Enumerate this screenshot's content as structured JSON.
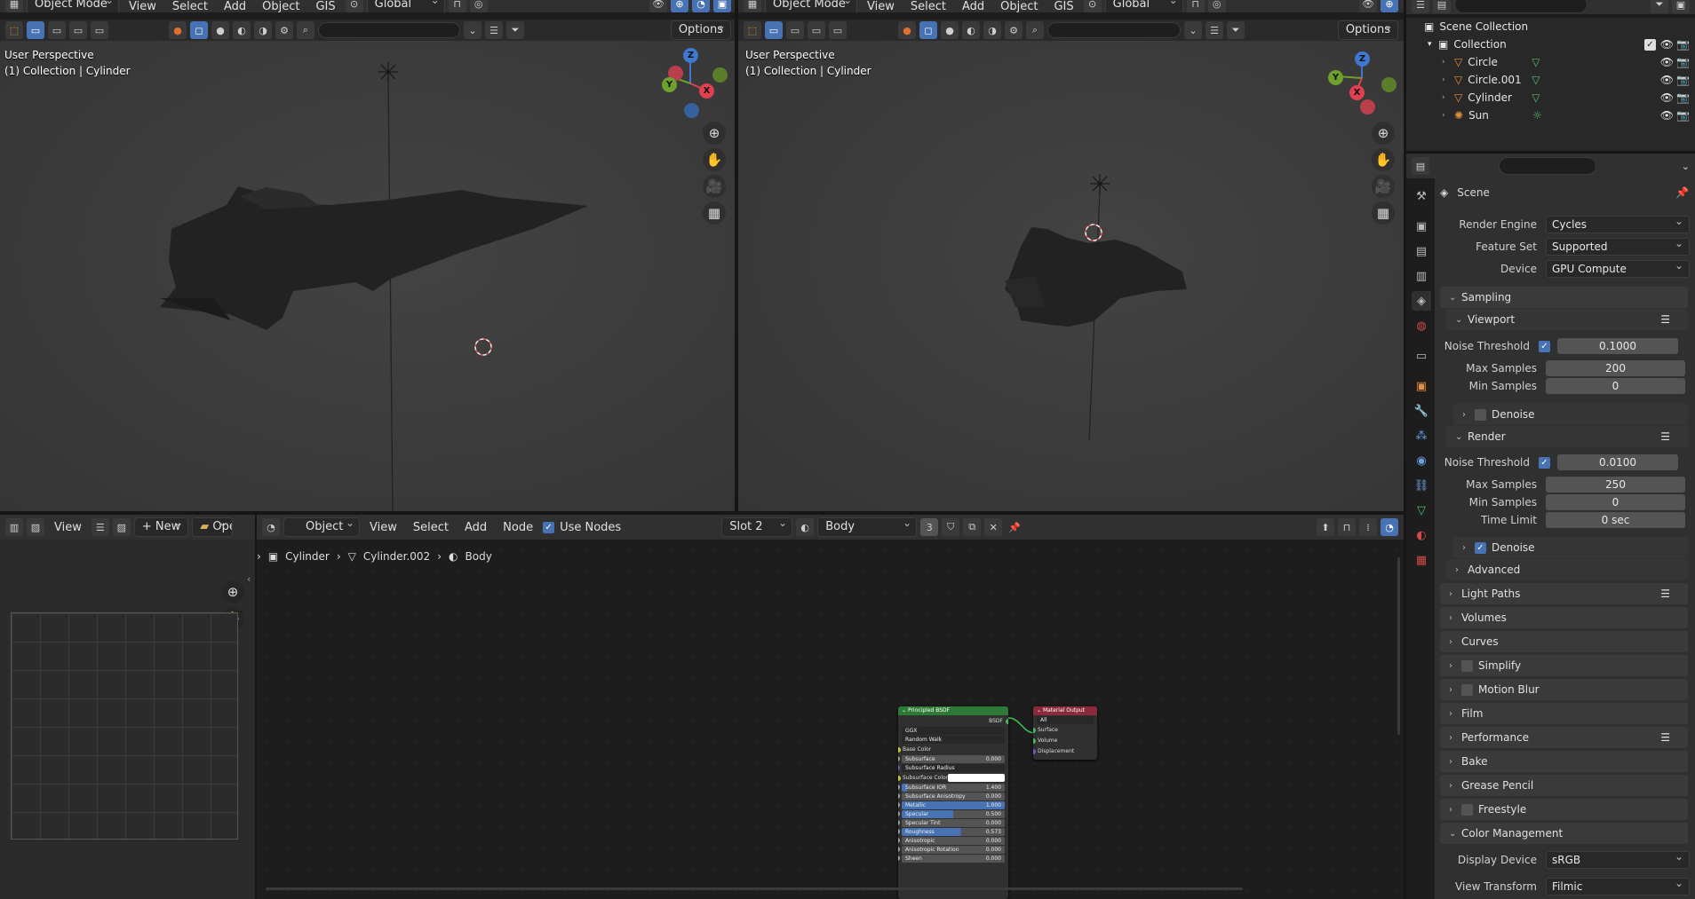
{
  "viewport_left": {
    "mode": "Object Mode",
    "menus": [
      "View",
      "Select",
      "Add",
      "Object",
      "GIS"
    ],
    "orientation": "Global",
    "options": "Options",
    "perspective": "User Perspective",
    "collection": "(1) Collection | Cylinder"
  },
  "viewport_right": {
    "mode": "Object Mode",
    "menus": [
      "View",
      "Select",
      "Add",
      "Object",
      "GIS"
    ],
    "orientation": "Global",
    "options": "Options",
    "perspective": "User Perspective",
    "collection": "(1) Collection | Cylinder"
  },
  "gizmo": {
    "x": "X",
    "y": "Y",
    "z": "Z"
  },
  "image_editor": {
    "view": "View",
    "new": "New",
    "open": "Open"
  },
  "node_editor": {
    "object_dropdown": "Object",
    "menus": [
      "View",
      "Select",
      "Add",
      "Node"
    ],
    "use_nodes": "Use Nodes",
    "slot": "Slot 2",
    "material": "Body",
    "users": "3",
    "breadcrumb": [
      "Cylinder",
      "Cylinder.002",
      "Body"
    ]
  },
  "principled_node": {
    "title": "Principled BSDF",
    "output": "BSDF",
    "distribution": "GGX",
    "subsurface_method": "Random Walk",
    "rows": [
      {
        "label": "Base Color",
        "type": "socket"
      },
      {
        "label": "Subsurface",
        "value": "0.000",
        "type": "bar",
        "fill": 0
      },
      {
        "label": "Subsurface Radius",
        "type": "drop"
      },
      {
        "label": "Subsurface Color",
        "type": "color"
      },
      {
        "label": "Subsurface IOR",
        "value": "1.400",
        "type": "bar",
        "fill": 0.05
      },
      {
        "label": "Subsurface Anisotropy",
        "value": "0.000",
        "type": "bar",
        "fill": 0
      },
      {
        "label": "Metallic",
        "value": "1.000",
        "type": "bar",
        "fill": 1
      },
      {
        "label": "Specular",
        "value": "0.500",
        "type": "bar",
        "fill": 0.5
      },
      {
        "label": "Specular Tint",
        "value": "0.000",
        "type": "bar",
        "fill": 0
      },
      {
        "label": "Roughness",
        "value": "0.573",
        "type": "bar",
        "fill": 0.573
      },
      {
        "label": "Anisotropic",
        "value": "0.000",
        "type": "bar",
        "fill": 0
      },
      {
        "label": "Anisotropic Rotation",
        "value": "0.000",
        "type": "bar",
        "fill": 0
      },
      {
        "label": "Sheen",
        "value": "0.000",
        "type": "bar",
        "fill": 0
      }
    ]
  },
  "output_node": {
    "title": "Material Output",
    "target": "All",
    "inputs": [
      "Surface",
      "Volume",
      "Displacement"
    ]
  },
  "outliner": {
    "root": "Scene Collection",
    "collection": "Collection",
    "items": [
      "Circle",
      "Circle.001",
      "Cylinder",
      "Sun"
    ]
  },
  "properties": {
    "context": "Scene",
    "render_engine_label": "Render Engine",
    "render_engine": "Cycles",
    "feature_set_label": "Feature Set",
    "feature_set": "Supported",
    "device_label": "Device",
    "device": "GPU Compute",
    "sampling": "Sampling",
    "viewport": "Viewport",
    "noise_threshold_label": "Noise Threshold",
    "viewport_noise_threshold": "0.1000",
    "max_samples_label": "Max Samples",
    "viewport_max_samples": "200",
    "min_samples_label": "Min Samples",
    "viewport_min_samples": "0",
    "denoise": "Denoise",
    "render": "Render",
    "render_noise_threshold": "0.0100",
    "render_max_samples": "250",
    "render_min_samples": "0",
    "time_limit_label": "Time Limit",
    "time_limit": "0 sec",
    "advanced": "Advanced",
    "panels": [
      "Light Paths",
      "Volumes",
      "Curves",
      "Simplify",
      "Motion Blur",
      "Film",
      "Performance",
      "Bake",
      "Grease Pencil",
      "Freestyle",
      "Color Management"
    ],
    "display_device_label": "Display Device",
    "display_device": "sRGB",
    "view_transform_label": "View Transform",
    "view_transform": "Filmic"
  },
  "colors": {
    "accent": "#4772b3",
    "x_axis": "#e0404f",
    "y_axis": "#6fa02e",
    "z_axis": "#3e78d0",
    "shader_node_header": "#2d7a36",
    "output_node_header": "#8a2b3c"
  }
}
